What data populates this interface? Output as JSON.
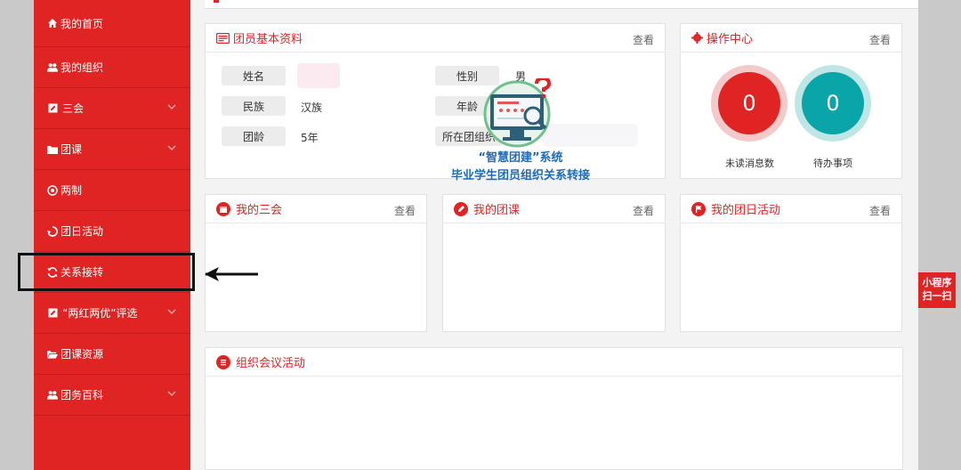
{
  "sidebar": {
    "items": [
      {
        "label": "我的首页",
        "icon": "home-icon"
      },
      {
        "label": "我的组织",
        "icon": "users-icon"
      },
      {
        "label": "三会",
        "icon": "edit-icon",
        "has_chevron": true
      },
      {
        "label": "团课",
        "icon": "folder-icon",
        "has_chevron": true
      },
      {
        "label": "两制",
        "icon": "target-icon"
      },
      {
        "label": "团日活动",
        "icon": "recycle-icon"
      },
      {
        "label": "关系接转",
        "icon": "refresh-icon"
      },
      {
        "label": "“两红两优”评选",
        "icon": "edit-icon",
        "has_chevron": true
      },
      {
        "label": "团课资源",
        "icon": "folder-open-icon"
      },
      {
        "label": "团务百科",
        "icon": "users-icon",
        "has_chevron": true
      }
    ]
  },
  "profile_panel": {
    "title": "团员基本资料",
    "more": "查看",
    "fields": {
      "name_label": "姓名",
      "gender_label": "性别",
      "gender_value": "男",
      "ethnicity_label": "民族",
      "ethnicity_value": "汉族",
      "age_label": "年龄",
      "league_age_label": "团龄",
      "league_age_value": "5年",
      "org_label": "所在团组织"
    }
  },
  "ops_panel": {
    "title": "操作中心",
    "more": "查看",
    "unread_count": "0",
    "unread_label": "未读消息数",
    "todo_count": "0",
    "todo_label": "待办事项"
  },
  "sanhui_panel": {
    "title": "我的三会",
    "more": "查看"
  },
  "tuanke_panel": {
    "title": "我的团课",
    "more": "查看"
  },
  "tuanri_panel": {
    "title": "我的团日活动",
    "more": "查看"
  },
  "meeting_panel": {
    "title": "组织会议活动"
  },
  "overlay": {
    "line1": "“智慧团建”系统",
    "line2": "毕业学生团员组织关系转接"
  },
  "mini_program": {
    "line1": "小程序",
    "line2": "扫一扫"
  },
  "colors": {
    "brand_red": "#e02323",
    "teal": "#0aa5a8",
    "overlay_blue": "#1d6bb7"
  }
}
